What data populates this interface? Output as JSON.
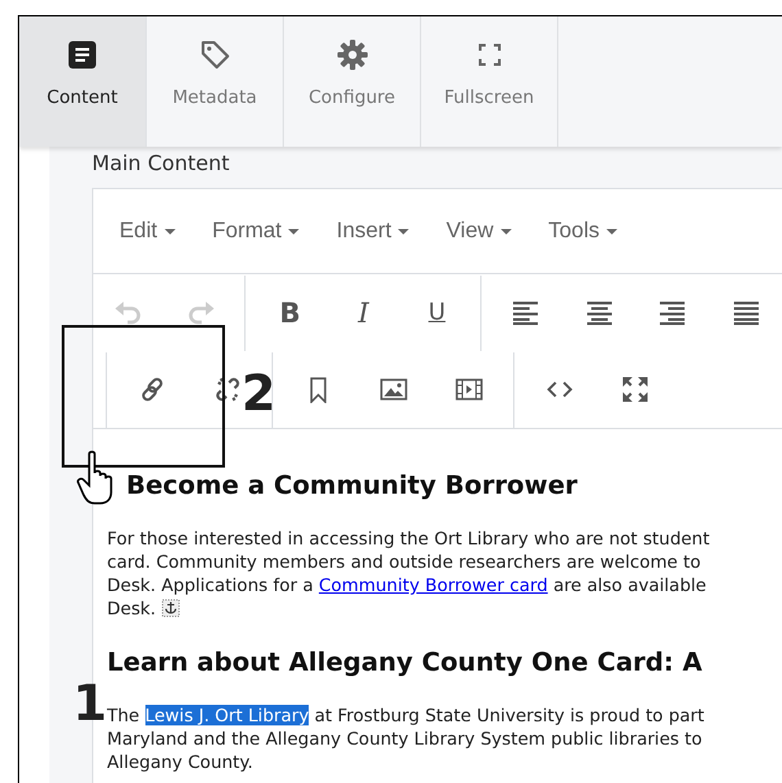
{
  "tabs": [
    {
      "label": "Content",
      "kind": "document",
      "selected": true
    },
    {
      "label": "Metadata",
      "kind": "tag",
      "selected": false
    },
    {
      "label": "Configure",
      "kind": "gear",
      "selected": false
    },
    {
      "label": "Fullscreen",
      "kind": "expand",
      "selected": false
    }
  ],
  "field_label": "Main Content",
  "menu": [
    "Edit",
    "Format",
    "Insert",
    "View",
    "Tools"
  ],
  "toolbar_rows": [
    [
      {
        "kind": "undo",
        "disabled": true
      },
      {
        "kind": "redo",
        "disabled": true
      },
      {
        "kind": "sep"
      },
      {
        "kind": "bold",
        "label": "B"
      },
      {
        "kind": "italic",
        "label": "I"
      },
      {
        "kind": "underline",
        "label": "U"
      },
      {
        "kind": "sep"
      },
      {
        "kind": "align-left"
      },
      {
        "kind": "align-center"
      },
      {
        "kind": "align-right"
      },
      {
        "kind": "align-justify"
      }
    ],
    [
      {
        "kind": "sep"
      },
      {
        "kind": "link"
      },
      {
        "kind": "unlink"
      },
      {
        "kind": "sep"
      },
      {
        "kind": "bookmark"
      },
      {
        "kind": "image"
      },
      {
        "kind": "video"
      },
      {
        "kind": "sep"
      },
      {
        "kind": "code"
      },
      {
        "kind": "fullscreen"
      }
    ]
  ],
  "document": [
    {
      "kind": "heading",
      "text": "Become a Community Borrower"
    },
    {
      "kind": "paragraph",
      "lines": [
        "For those interested in accessing the Ort Library who are not student",
        "card. Community members and outside researchers are welcome to",
        [
          {
            "text": "Desk. Applications for a "
          },
          {
            "text": "Community Borrower card",
            "link": true
          },
          {
            "text": " are also available"
          }
        ],
        [
          {
            "text": "Desk. "
          },
          {
            "anchor": true
          }
        ]
      ]
    },
    {
      "kind": "heading",
      "text": "Learn about Allegany County One Card: A"
    },
    {
      "kind": "paragraph",
      "lines": [
        [
          {
            "text": "The "
          },
          {
            "text": "Lewis J. Ort Library",
            "highlighted": true
          },
          {
            "text": " at Frostburg State University is proud to part"
          }
        ],
        "Maryland and the Allegany County Library System public libraries to",
        "Allegany County."
      ]
    }
  ],
  "annotations": [
    {
      "label": "2"
    },
    {
      "label": "1"
    }
  ]
}
